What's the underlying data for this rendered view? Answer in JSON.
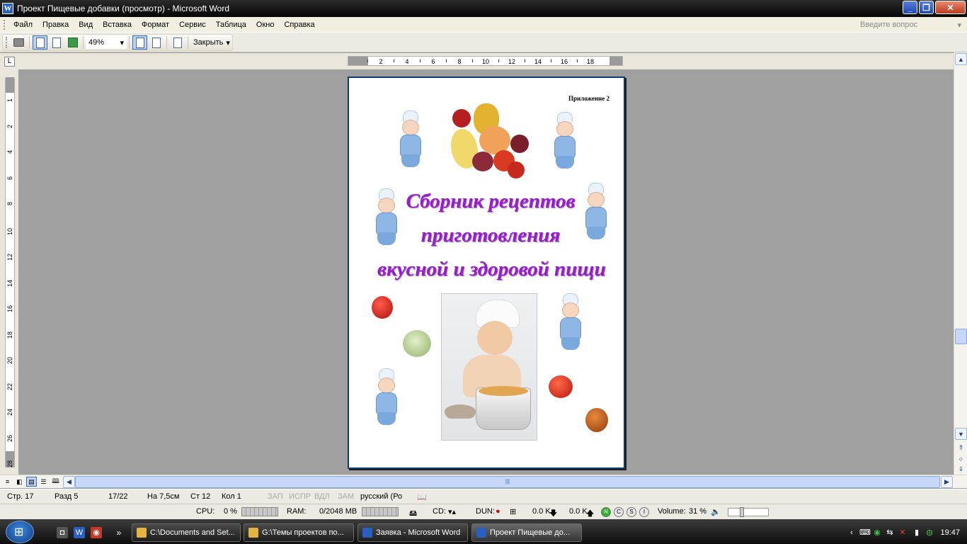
{
  "window": {
    "title": "Проект Пищевые добавки (просмотр) - Microsoft Word",
    "app_icon": "W"
  },
  "menu": {
    "items": [
      "Файл",
      "Правка",
      "Вид",
      "Вставка",
      "Формат",
      "Сервис",
      "Таблица",
      "Окно",
      "Справка"
    ],
    "question_placeholder": "Введите вопрос"
  },
  "toolbar": {
    "zoom": "49%",
    "close_label": "Закрыть"
  },
  "ruler": {
    "h_ticks": [
      "2",
      "4",
      "6",
      "8",
      "10",
      "12",
      "14",
      "16",
      "18"
    ],
    "v_ticks": [
      "1",
      "2",
      "4",
      "6",
      "8",
      "10",
      "12",
      "14",
      "16",
      "18",
      "20",
      "22",
      "24",
      "26",
      "28"
    ]
  },
  "document": {
    "appendix": "Приложение 2",
    "title_lines": [
      "Сборник рецептов",
      "приготовления",
      "вкусной и здоровой пищи"
    ],
    "title_color": "#9320c4"
  },
  "status": {
    "page": "Стр. 17",
    "section": "Разд 5",
    "pages": "17/22",
    "at": "На 7,5см",
    "line": "Ст 12",
    "col": "Кол 1",
    "rec": "ЗАП",
    "trk": "ИСПР",
    "ext": "ВДЛ",
    "ovr": "ЗАМ",
    "lang": "русский (Ро"
  },
  "sysmon": {
    "cpu_label": "CPU:",
    "cpu_value": "0 %",
    "ram_label": "RAM:",
    "ram_value": "0/2048 MB",
    "cd_label": "CD:",
    "dun_label": "DUN:",
    "down": "0.0 K",
    "up": "0.0 K",
    "n": "N",
    "c": "C",
    "s": "S",
    "i": "I",
    "volume_label": "Volume:",
    "volume_value": "31 %"
  },
  "taskbar": {
    "tasks": [
      "C:\\Documents and Set...",
      "G:\\Темы проектов по...",
      "Заявка - Microsoft Word",
      "Проект Пищевые до..."
    ],
    "clock": "19:47"
  }
}
